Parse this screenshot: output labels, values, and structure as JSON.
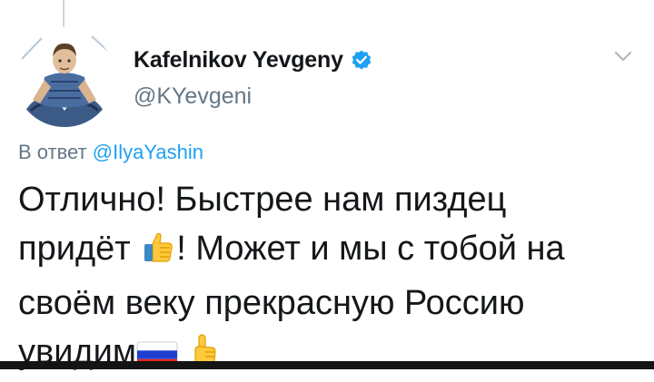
{
  "tweet": {
    "author": {
      "display_name": "Kafelnikov Yevgeny",
      "handle": "@KYevgeni",
      "verified": true
    },
    "reply_to": {
      "prefix": "В ответ",
      "mention": "@IlyaYashin"
    },
    "text_parts": {
      "p1": "Отлично! Быстрее нам пиздец",
      "p2": "придёт",
      "p3": "! Может и мы с тобой на",
      "p4": "своём веку прекрасную Россию",
      "p5": "увидим"
    },
    "emojis": [
      "thumbs-up-icon",
      "russia-flag-icon",
      "pointing-up-icon"
    ]
  },
  "colors": {
    "text": "#14171a",
    "secondary": "#657786",
    "link": "#1da1f2",
    "verified_badge": "#1da1f2"
  }
}
